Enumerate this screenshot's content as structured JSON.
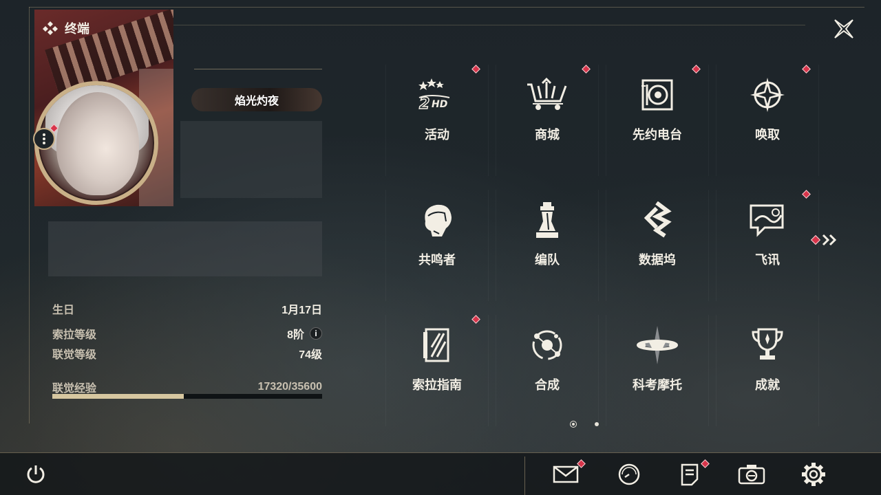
{
  "header": {
    "title": "终端"
  },
  "profile": {
    "badge_title": "焰光灼夜",
    "birthday_label": "生日",
    "birthday_value": "1月17日",
    "sora_level_label": "索拉等级",
    "sora_level_value": "8阶",
    "union_level_label": "联觉等级",
    "union_level_value": "74级",
    "union_exp_label": "联觉经验",
    "union_exp_value": "17320/35600",
    "union_exp_progress": 0.4865
  },
  "menu": [
    {
      "label": "活动",
      "icon": "event-2hd-icon",
      "badge": true
    },
    {
      "label": "商城",
      "icon": "shop-cart-icon",
      "badge": true
    },
    {
      "label": "先约电台",
      "icon": "radio-icon",
      "badge": true
    },
    {
      "label": "唤取",
      "icon": "convene-star-icon",
      "badge": true
    },
    {
      "label": "共鸣者",
      "icon": "resonator-icon",
      "badge": false
    },
    {
      "label": "编队",
      "icon": "team-chess-icon",
      "badge": false
    },
    {
      "label": "数据坞",
      "icon": "data-bank-icon",
      "badge": false
    },
    {
      "label": "飞讯",
      "icon": "chat-message-icon",
      "badge": true
    },
    {
      "label": "索拉指南",
      "icon": "guidebook-icon",
      "badge": true
    },
    {
      "label": "合成",
      "icon": "synthesis-icon",
      "badge": false
    },
    {
      "label": "科考摩托",
      "icon": "motorbike-icon",
      "badge": false
    },
    {
      "label": "成就",
      "icon": "trophy-icon",
      "badge": false
    }
  ],
  "pagination": {
    "current": 1,
    "total": 2
  },
  "bottom": {
    "power": "power-icon",
    "mail": "mail-icon",
    "clock": "clock-icon",
    "notes": "notes-icon",
    "camera": "camera-icon",
    "settings": "gear-icon"
  },
  "colors": {
    "accent_gold": "#c9b088",
    "badge_red": "#d8344a",
    "text_light": "#f2eee4",
    "exp_fill": "#d7c7a0"
  }
}
